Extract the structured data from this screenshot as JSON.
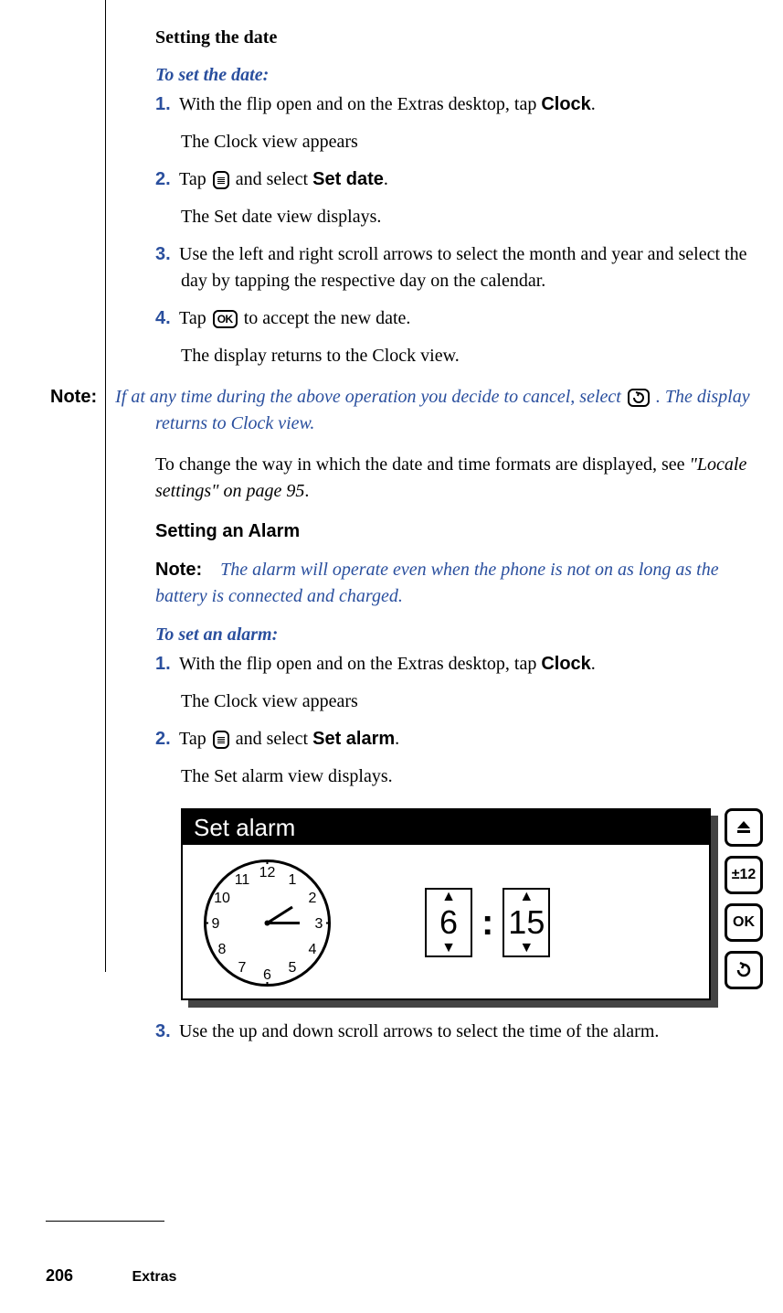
{
  "title": "Setting the date",
  "to_set_date": "To set the date:",
  "steps_date": {
    "s1a": "With the flip open and on the Extras desktop, tap ",
    "s1_bold": "Clock",
    "s1b": ".",
    "s1_res": "The Clock view appears",
    "s2a": "Tap ",
    "s2b": " and select ",
    "s2_bold": "Set date",
    "s2c": ".",
    "s2_res": "The Set date view displays.",
    "s3": "Use the left and right scroll arrows to select the month and year and select the day by tapping the respective day on the calendar.",
    "s4a": "Tap ",
    "s4b": " to accept the new date.",
    "s4_res": "The display returns to the Clock view."
  },
  "note1": {
    "label": "Note:",
    "text_a": "If at any time during the above operation you decide to cancel, select ",
    "text_b": ". The display returns to Clock view."
  },
  "change_format_a": "To change the way in which the date and time formats are displayed, see ",
  "change_format_ref": "\"Locale settings\" on page 95",
  "change_format_b": ".",
  "section_alarm": "Setting an Alarm",
  "note2": {
    "label": "Note:",
    "text": "The alarm will operate even when the phone is not on as long as the battery is connected and charged."
  },
  "to_set_alarm": "To set an alarm:",
  "steps_alarm": {
    "s1a": "With the flip open and on the Extras desktop, tap ",
    "s1_bold": "Clock",
    "s1b": ".",
    "s1_res": "The Clock view appears",
    "s2a": "Tap ",
    "s2b": " and select ",
    "s2_bold": "Set alarm",
    "s2c": ".",
    "s2_res": "The Set alarm view displays.",
    "s3": "Use the up and down scroll arrows to select the time of the alarm."
  },
  "alarm_shot": {
    "title": "Set alarm",
    "hour": "6",
    "minute": "15",
    "pm12": "±12",
    "ok": "OK"
  },
  "icons": {
    "ok": "OK",
    "menu": "≡",
    "back": "↺"
  },
  "chart_data": {
    "type": "clock",
    "clock_numbers": [
      "12",
      "1",
      "2",
      "3",
      "4",
      "5",
      "6",
      "7",
      "8",
      "9",
      "10",
      "11"
    ],
    "hour_hand_at": 3,
    "minute_hand_approx": 2,
    "spinner_hour": 6,
    "spinner_minute": 15,
    "side_buttons": [
      "up-arrow",
      "±12",
      "OK",
      "back"
    ]
  },
  "footer": {
    "page": "206",
    "section": "Extras"
  },
  "nums": {
    "n1": "1.",
    "n2": "2.",
    "n3": "3.",
    "n4": "4."
  }
}
